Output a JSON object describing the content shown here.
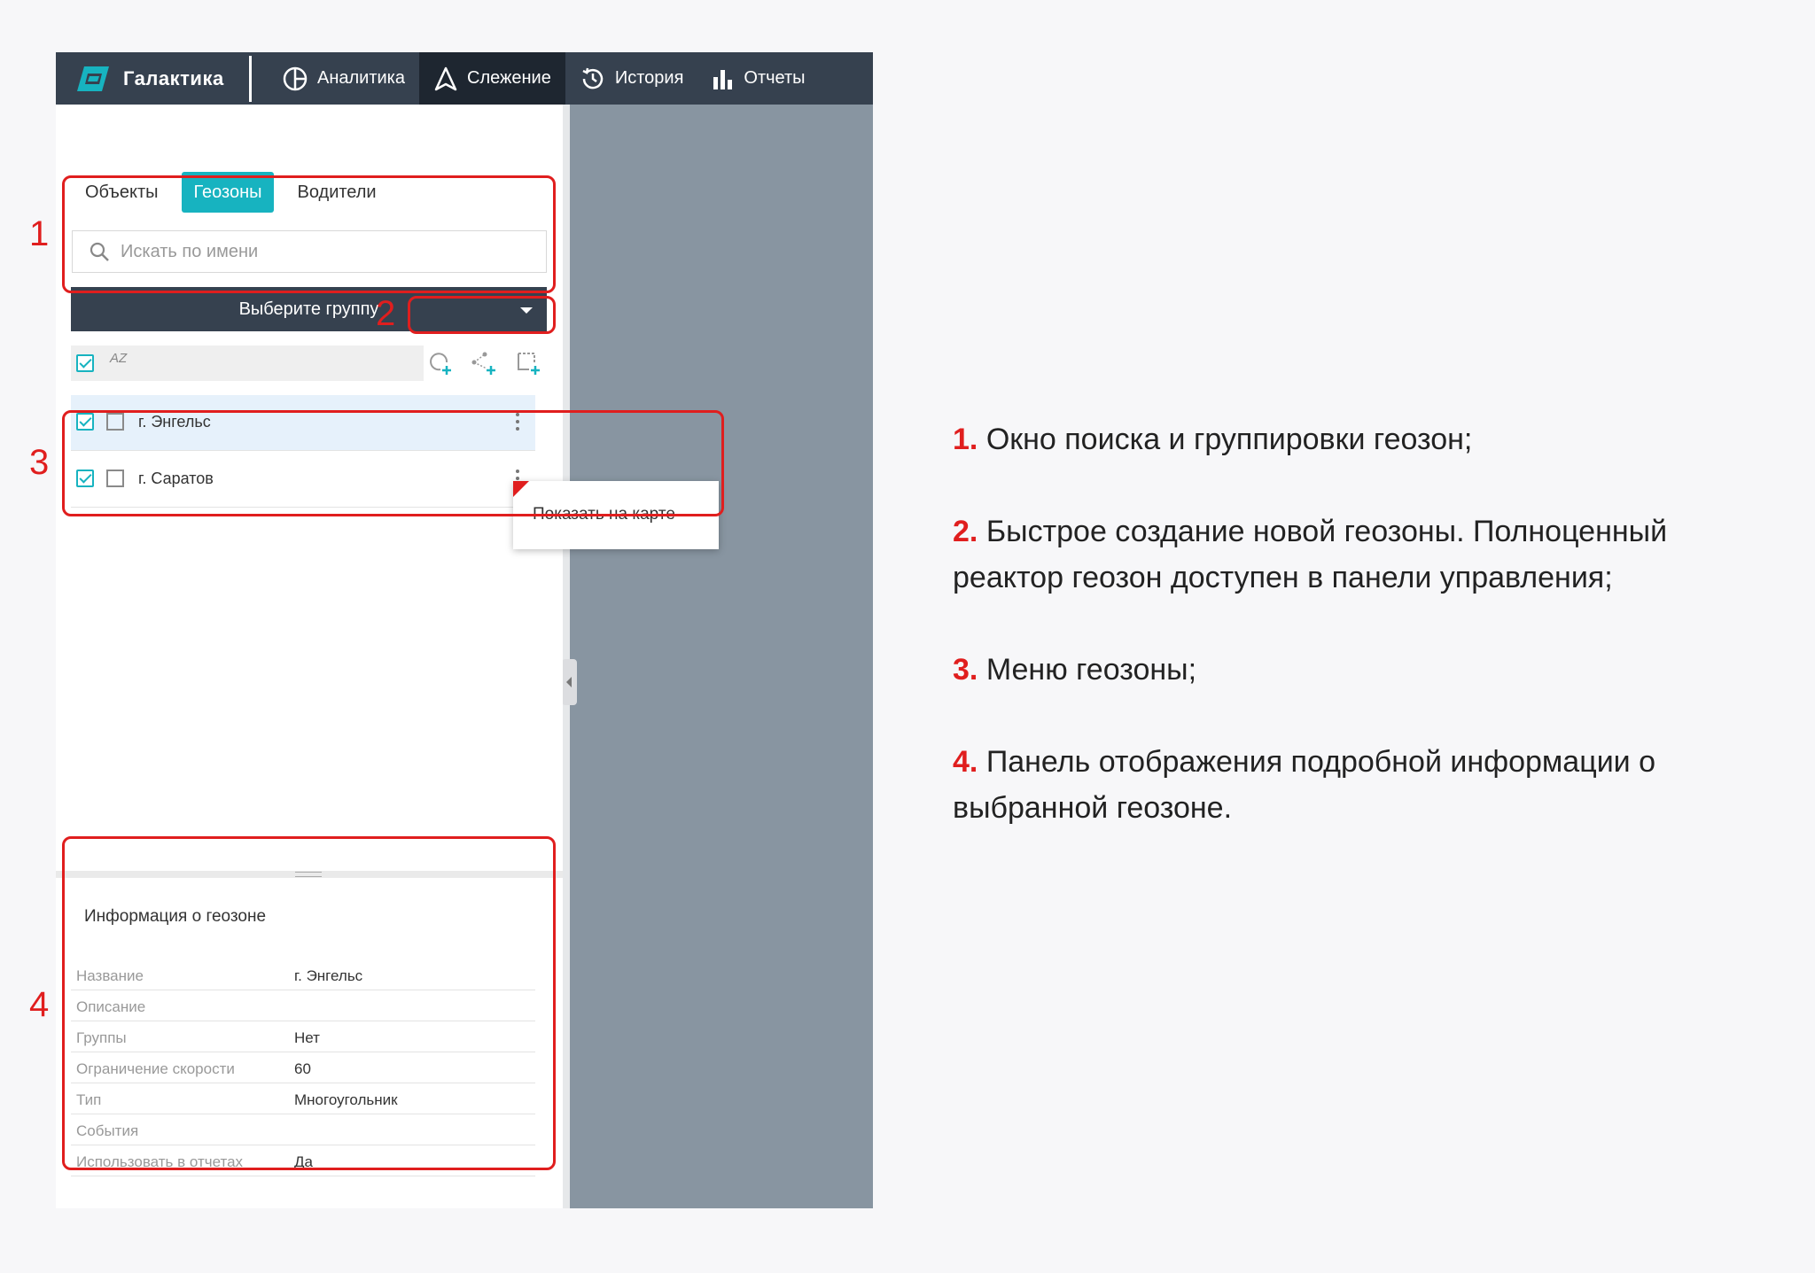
{
  "nav": {
    "logo_text": "Галактика",
    "items": [
      {
        "label": "Аналитика"
      },
      {
        "label": "Слежение"
      },
      {
        "label": "История"
      },
      {
        "label": "Отчеты"
      }
    ]
  },
  "tabs": [
    "Объекты",
    "Геозоны",
    "Водители"
  ],
  "search": {
    "placeholder": "Искать по имени"
  },
  "group_select": {
    "label": "Выберите группу"
  },
  "toolbar": {
    "sort_label": "AZ"
  },
  "geozones": [
    {
      "name": "г. Энгельс"
    },
    {
      "name": "г. Саратов"
    }
  ],
  "popup": {
    "label": "Показать на карте"
  },
  "info": {
    "title": "Информация о геозоне",
    "rows": [
      {
        "key": "Название",
        "value": "г. Энгельс"
      },
      {
        "key": "Описание",
        "value": ""
      },
      {
        "key": "Группы",
        "value": "Нет"
      },
      {
        "key": "Ограничение скорости",
        "value": "60"
      },
      {
        "key": "Тип",
        "value": "Многоугольник"
      },
      {
        "key": "События",
        "value": ""
      },
      {
        "key": "Использовать в отчетах",
        "value": "Да"
      }
    ]
  },
  "annotations": [
    "1",
    "2",
    "3",
    "4"
  ],
  "descriptions": [
    {
      "num": "1.",
      "text": "Окно поиска и группировки геозон;"
    },
    {
      "num": "2.",
      "text": "Быстрое создание новой геозоны. Полноценный реактор геозон доступен в панели управления;"
    },
    {
      "num": "3.",
      "text": "Меню геозоны;"
    },
    {
      "num": "4.",
      "text": "Панель отображения подробной информации о выбранной геозоне."
    }
  ],
  "colors": {
    "accent": "#17b3c0",
    "nav": "#36414f",
    "highlight": "#e01e1e",
    "map": "#8895a1"
  }
}
